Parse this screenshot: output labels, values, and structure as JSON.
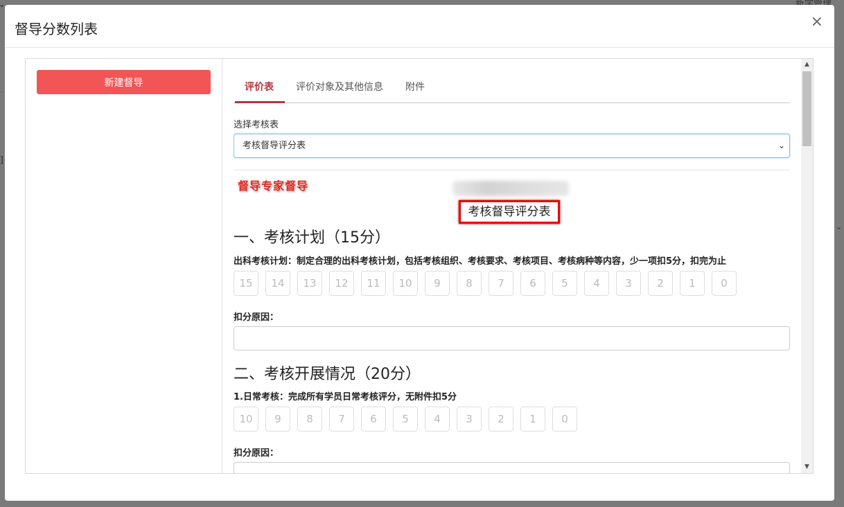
{
  "backdrop": {
    "top_right_text": "新学管理"
  },
  "modal": {
    "title": "督导分数列表",
    "close": "×"
  },
  "left_panel": {
    "new_button": "新建督导"
  },
  "tabs": [
    {
      "label": "评价表",
      "active": true
    },
    {
      "label": "评价对象及其他信息",
      "active": false
    },
    {
      "label": "附件",
      "active": false
    }
  ],
  "form": {
    "select_label": "选择考核表",
    "select_value": "考核督导评分表",
    "stamp": "督导专家督导",
    "sheet_title": "考核督导评分表",
    "sections": [
      {
        "title": "一、考核计划（15分）",
        "items": [
          {
            "desc": "出科考核计划：制定合理的出科考核计划，包括考核组织、考核要求、考核项目、考核病种等内容，少一项扣5分，扣完为止",
            "scores": [
              "15",
              "14",
              "13",
              "12",
              "11",
              "10",
              "9",
              "8",
              "7",
              "6",
              "5",
              "4",
              "3",
              "2",
              "1",
              "0"
            ],
            "reason_label": "扣分原因："
          }
        ]
      },
      {
        "title": "二、考核开展情况（20分）",
        "items": [
          {
            "desc": "1.日常考核：完成所有学员日常考核评分，无附件扣5分",
            "scores": [
              "10",
              "9",
              "8",
              "7",
              "6",
              "5",
              "4",
              "3",
              "2",
              "1",
              "0"
            ],
            "reason_label": "扣分原因："
          }
        ]
      }
    ]
  },
  "colors": {
    "accent": "#b6333f",
    "button": "#f25555",
    "stamp": "#e2231a"
  }
}
